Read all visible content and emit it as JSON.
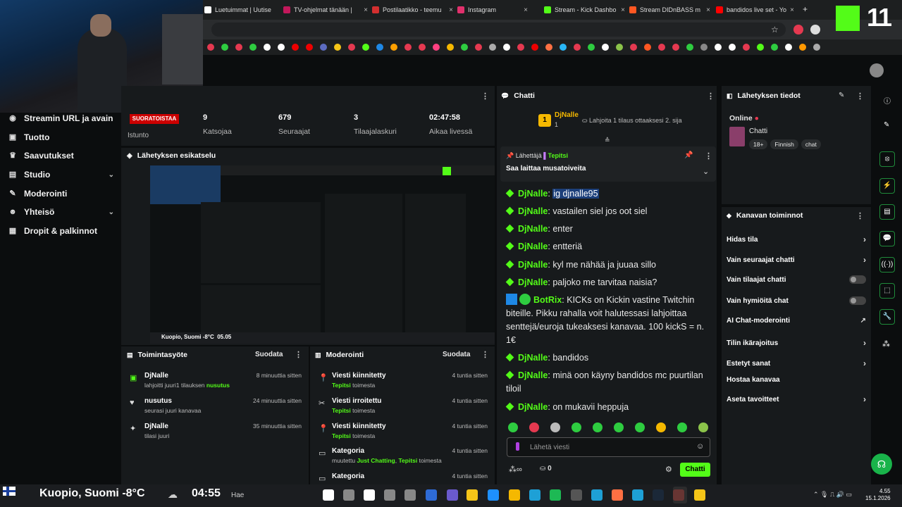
{
  "tabs": [
    {
      "label": "Luetuimmat | Uutiset",
      "color": "#ffffff"
    },
    {
      "label": "TV-ohjelmat tänään |",
      "color": "#c2185b"
    },
    {
      "label": "Postilaatikko - teemu",
      "color": "#d32f2f"
    },
    {
      "label": "Instagram",
      "color": "#e1306c"
    },
    {
      "label": "Stream - Kick Dashbo",
      "color": "#53fc18"
    },
    {
      "label": "Stream DIDnBASS m",
      "color": "#ff5722"
    },
    {
      "label": "bandidos live set - Yo",
      "color": "#ff0000"
    }
  ],
  "kick_badge": "11",
  "nav": [
    {
      "label": "Streamin URL ja avain",
      "icon": "broadcast-icon",
      "glyph": "◉"
    },
    {
      "label": "Tuotto",
      "icon": "money-icon",
      "glyph": "▣"
    },
    {
      "label": "Saavutukset",
      "icon": "trophy-icon",
      "glyph": "♛"
    },
    {
      "label": "Studio",
      "icon": "studio-icon",
      "glyph": "▤",
      "chev": "⌄"
    },
    {
      "label": "Moderointi",
      "icon": "wrench-icon",
      "glyph": "✎"
    },
    {
      "label": "Yhteisö",
      "icon": "people-icon",
      "glyph": "☻",
      "chev": "⌄"
    },
    {
      "label": "Dropit & palkinnot",
      "icon": "gift-icon",
      "glyph": "▦"
    }
  ],
  "stats": {
    "badge": "SUORATOISTAA",
    "session_label": "Istunto",
    "items": [
      {
        "value": "9",
        "label": "Katsojaa"
      },
      {
        "value": "679",
        "label": "Seuraajat"
      },
      {
        "value": "3",
        "label": "Tilaajalaskuri"
      },
      {
        "value": "02:47:58",
        "label": "Aikaa livessä"
      }
    ]
  },
  "preview": {
    "title": "Lähetyksen esikatselu",
    "location": "Kuopio, Suomi -8°C",
    "time": "05.05"
  },
  "activity": {
    "title": "Toimintasyöte",
    "filter": "Suodata",
    "items": [
      {
        "title": "DjNalle",
        "sub": "lahjoitti juuri",
        "sub2": "1 tilauksen ",
        "sub3": "nusutus",
        "time": "8 minuuttia sitten",
        "icon": "gift-icon"
      },
      {
        "title": "nusutus",
        "sub": "seurasi juuri kanavaa",
        "time": "24 minuuttia sitten",
        "icon": "heart-icon"
      },
      {
        "title": "DjNalle",
        "sub": "tilasi juuri",
        "time": "35 minuuttia sitten",
        "icon": "star-icon"
      }
    ]
  },
  "moderation": {
    "title": "Moderointi",
    "filter": "Suodata",
    "items": [
      {
        "title": "Viesti kiinnitetty",
        "user": "Tepitsi",
        "rest": " toimesta",
        "time": "4 tuntia sitten",
        "icon": "pin-icon"
      },
      {
        "title": "Viesti irroitettu",
        "user": "Tepitsi",
        "rest": " toimesta",
        "time": "4 tuntia sitten",
        "icon": "unpin-icon"
      },
      {
        "title": "Viesti kiinnitetty",
        "user": "Tepitsi",
        "rest": " toimesta",
        "time": "4 tuntia sitten",
        "icon": "pin-icon"
      },
      {
        "title": "Kategoria",
        "pre": "muutettu ",
        "cat": "Just Chatting",
        "user": "Tepitsi",
        "rest": " toimesta",
        "time": "4 tuntia sitten",
        "icon": "category-icon"
      },
      {
        "title": "Kategoria",
        "time": "4 tuntia sitten",
        "icon": "category-icon"
      }
    ]
  },
  "chat": {
    "title": "Chatti",
    "top_user": "DjNalle",
    "top_count": "1",
    "top_text": "Lahjoita 1 tilaus ottaaksesi 2. sija",
    "pinned_by_label": "Lähettäjä",
    "pinned_by": "Tepitsi",
    "pinned_text": "Saa laittaa musatoiveita",
    "messages": [
      {
        "user": "DjNalle",
        "text": "ig djnalle95"
      },
      {
        "user": "DjNalle",
        "text": "vastailen siel jos oot siel"
      },
      {
        "user": "DjNalle",
        "text": "enter"
      },
      {
        "user": "DjNalle",
        "text": "entteriä"
      },
      {
        "user": "DjNalle",
        "text": "kyl me nähää ja juuaa sillo"
      },
      {
        "user": "DjNalle",
        "text": "paljoko me tarvitaa naisia?"
      },
      {
        "user": "BotRix",
        "text": "KICKs on Kickin vastine Twitchin biteille. Pikku rahalla voit halutessasi lahjoittaa senttejä/euroja tukeaksesi kanavaa. 100 kickS = n. 1€"
      },
      {
        "user": "DjNalle",
        "text": "bandidos"
      },
      {
        "user": "DjNalle",
        "text": "minä oon käyny bandidos mc puurtilan tiloil"
      },
      {
        "user": "DjNalle",
        "text": "on mukavii heppuja"
      }
    ],
    "input_placeholder": "Lähetä viesti",
    "kicks_count": "0",
    "send_label": "Chatti"
  },
  "info": {
    "title": "Lähetyksen tiedot",
    "status": "Online",
    "category": "Chatti",
    "tags": [
      "18+",
      "Finnish",
      "chat"
    ]
  },
  "actions": {
    "title": "Kanavan toiminnot",
    "items": [
      {
        "label": "Hidas tila",
        "kind": "chev"
      },
      {
        "label": "Vain seuraajat chatti",
        "kind": "chev"
      },
      {
        "label": "Vain tilaajat chatti",
        "kind": "toggle"
      },
      {
        "label": "Vain hymiöitä chat",
        "kind": "toggle"
      },
      {
        "label": "AI Chat-moderointi",
        "kind": "ext"
      },
      {
        "label": "Tilin ikärajoitus",
        "kind": "chev"
      },
      {
        "label": "Estetyt sanat",
        "kind": "chev"
      },
      {
        "label": "Hostaa kanavaa",
        "kind": "none"
      },
      {
        "label": "Aseta tavoitteet",
        "kind": "chev"
      }
    ]
  },
  "taskbar": {
    "weather": "Kuopio, Suomi -8°C",
    "stream_time": "04:55",
    "search": "Hae",
    "clock_time": "4.55",
    "clock_date": "15.1.2026"
  }
}
